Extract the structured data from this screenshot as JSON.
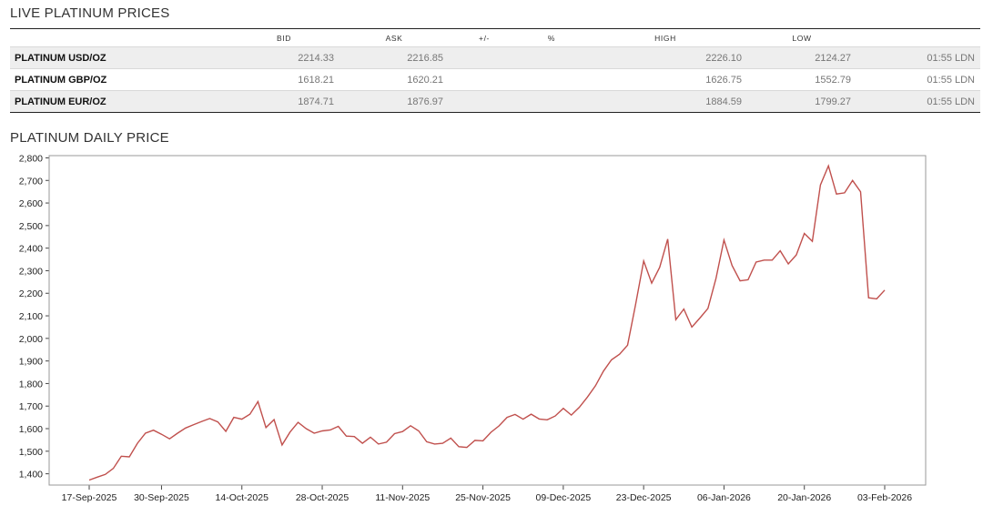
{
  "prices_section": {
    "title": "LIVE PLATINUM PRICES",
    "columns": [
      "",
      "BID",
      "ASK",
      "+/-",
      "%",
      "HIGH",
      "LOW",
      ""
    ],
    "rows": [
      {
        "name": "PLATINUM USD/OZ",
        "bid": "2214.33",
        "ask": "2216.85",
        "change": "",
        "pct": "",
        "high": "2226.10",
        "low": "2124.27",
        "time": "01:55 LDN"
      },
      {
        "name": "PLATINUM GBP/OZ",
        "bid": "1618.21",
        "ask": "1620.21",
        "change": "",
        "pct": "",
        "high": "1626.75",
        "low": "1552.79",
        "time": "01:55 LDN"
      },
      {
        "name": "PLATINUM EUR/OZ",
        "bid": "1874.71",
        "ask": "1876.97",
        "change": "",
        "pct": "",
        "high": "1884.59",
        "low": "1799.27",
        "time": "01:55 LDN"
      }
    ]
  },
  "chart_section": {
    "title": "PLATINUM DAILY PRICE"
  },
  "colors": {
    "line": "#c0504d",
    "frame": "#999999",
    "row_shade": "#eeeeee"
  },
  "chart_data": {
    "type": "line",
    "title": "PLATINUM DAILY PRICE",
    "xlabel": "",
    "ylabel": "",
    "ylim": [
      1350,
      2810
    ],
    "grid": false,
    "y_ticks": [
      "1,400",
      "1,500",
      "1,600",
      "1,700",
      "1,800",
      "1,900",
      "2,000",
      "2,100",
      "2,200",
      "2,300",
      "2,400",
      "2,500",
      "2,600",
      "2,700",
      "2,800"
    ],
    "y_tick_values": [
      1400,
      1500,
      1600,
      1700,
      1800,
      1900,
      2000,
      2100,
      2200,
      2300,
      2400,
      2500,
      2600,
      2700,
      2800
    ],
    "x_ticks": [
      "17-Sep-2025",
      "30-Sep-2025",
      "14-Oct-2025",
      "28-Oct-2025",
      "11-Nov-2025",
      "25-Nov-2025",
      "09-Dec-2025",
      "23-Dec-2025",
      "06-Jan-2026",
      "20-Jan-2026",
      "03-Feb-2026"
    ],
    "x_tick_index": [
      0,
      9,
      19,
      29,
      39,
      49,
      59,
      69,
      79,
      89,
      99
    ],
    "series": [
      {
        "values": [
          1372,
          1385,
          1397,
          1424,
          1478,
          1475,
          1535,
          1580,
          1593,
          1575,
          1555,
          1580,
          1603,
          1618,
          1632,
          1645,
          1630,
          1588,
          1650,
          1642,
          1664,
          1720,
          1605,
          1640,
          1528,
          1585,
          1628,
          1600,
          1580,
          1590,
          1594,
          1610,
          1567,
          1565,
          1535,
          1562,
          1532,
          1540,
          1578,
          1587,
          1613,
          1590,
          1542,
          1532,
          1535,
          1558,
          1520,
          1517,
          1548,
          1546,
          1584,
          1612,
          1650,
          1663,
          1642,
          1664,
          1643,
          1639,
          1656,
          1690,
          1660,
          1695,
          1740,
          1790,
          1855,
          1905,
          1930,
          1970,
          2150,
          2343,
          2245,
          2315,
          2440,
          2083,
          2130,
          2050,
          2090,
          2133,
          2265,
          2436,
          2323,
          2255,
          2260,
          2338,
          2347,
          2347,
          2388,
          2330,
          2370,
          2465,
          2430,
          2680,
          2765,
          2640,
          2645,
          2700,
          2650,
          2180,
          2175,
          2214
        ]
      }
    ]
  }
}
